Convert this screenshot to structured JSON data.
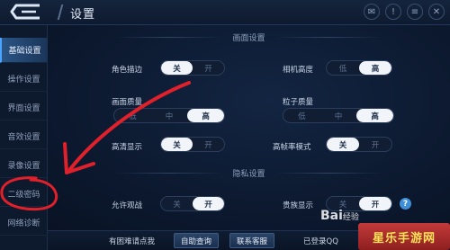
{
  "header": {
    "title": "设置"
  },
  "sidebar": {
    "items": [
      {
        "label": "基础设置"
      },
      {
        "label": "操作设置"
      },
      {
        "label": "界面设置"
      },
      {
        "label": "音效设置"
      },
      {
        "label": "录像设置"
      },
      {
        "label": "二级密码"
      },
      {
        "label": "网络诊断"
      }
    ]
  },
  "sections": {
    "graphics": "画面设置",
    "privacy": "隐私设置"
  },
  "settings": {
    "outline": {
      "label": "角色描边",
      "options": [
        "关",
        "开"
      ],
      "selected": "关"
    },
    "camera_height": {
      "label": "相机高度",
      "options": [
        "低",
        "高"
      ],
      "selected": "高"
    },
    "quality": {
      "label": "画面质量",
      "options": [
        "低",
        "中",
        "高"
      ],
      "selected": "高"
    },
    "particle": {
      "label": "粒子质量",
      "options": [
        "低",
        "中",
        "高"
      ],
      "selected": "高"
    },
    "hd": {
      "label": "高清显示",
      "options": [
        "关",
        "开"
      ],
      "selected": "关"
    },
    "high_fps": {
      "label": "高帧率模式",
      "options": [
        "关",
        "开"
      ],
      "selected": "关"
    },
    "allow_watch": {
      "label": "允许观战",
      "options": [
        "关",
        "开"
      ],
      "selected": "开"
    },
    "noble": {
      "label": "贵族显示",
      "options": [
        "关",
        "开"
      ],
      "selected": "开"
    }
  },
  "help": {
    "symbol": "?"
  },
  "footer": {
    "question": "有困难请点我",
    "self_service": "自助查询",
    "customer_service": "联系客服",
    "login_status": "已登录QQ"
  },
  "watermarks": {
    "baidu": "Bai",
    "baidu_suffix": "经验",
    "site": "星乐手游网"
  },
  "colors": {
    "accent": "#4aa3ff",
    "annotation": "#e0202a"
  }
}
